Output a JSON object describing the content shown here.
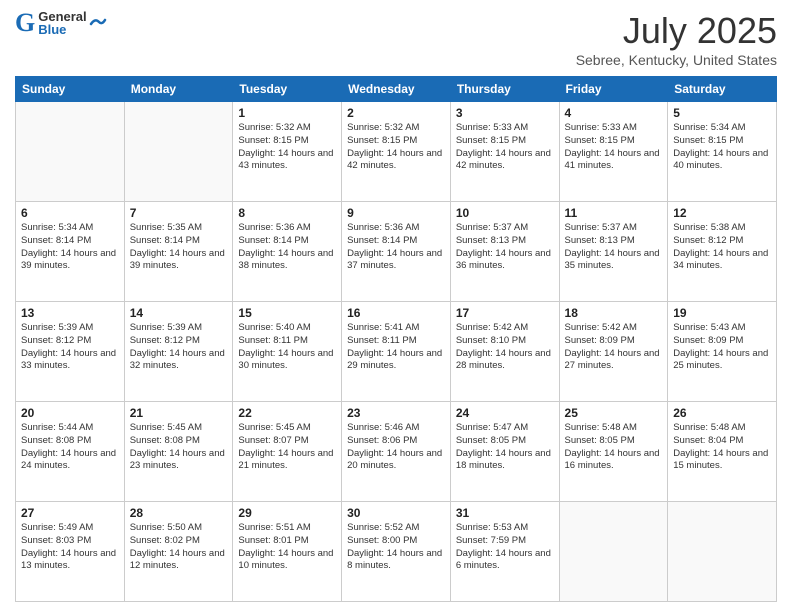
{
  "header": {
    "logo_general": "General",
    "logo_blue": "Blue",
    "title": "July 2025",
    "subtitle": "Sebree, Kentucky, United States"
  },
  "days_of_week": [
    "Sunday",
    "Monday",
    "Tuesday",
    "Wednesday",
    "Thursday",
    "Friday",
    "Saturday"
  ],
  "weeks": [
    [
      {
        "day": "",
        "content": ""
      },
      {
        "day": "",
        "content": ""
      },
      {
        "day": "1",
        "content": "Sunrise: 5:32 AM\nSunset: 8:15 PM\nDaylight: 14 hours and 43 minutes."
      },
      {
        "day": "2",
        "content": "Sunrise: 5:32 AM\nSunset: 8:15 PM\nDaylight: 14 hours and 42 minutes."
      },
      {
        "day": "3",
        "content": "Sunrise: 5:33 AM\nSunset: 8:15 PM\nDaylight: 14 hours and 42 minutes."
      },
      {
        "day": "4",
        "content": "Sunrise: 5:33 AM\nSunset: 8:15 PM\nDaylight: 14 hours and 41 minutes."
      },
      {
        "day": "5",
        "content": "Sunrise: 5:34 AM\nSunset: 8:15 PM\nDaylight: 14 hours and 40 minutes."
      }
    ],
    [
      {
        "day": "6",
        "content": "Sunrise: 5:34 AM\nSunset: 8:14 PM\nDaylight: 14 hours and 39 minutes."
      },
      {
        "day": "7",
        "content": "Sunrise: 5:35 AM\nSunset: 8:14 PM\nDaylight: 14 hours and 39 minutes."
      },
      {
        "day": "8",
        "content": "Sunrise: 5:36 AM\nSunset: 8:14 PM\nDaylight: 14 hours and 38 minutes."
      },
      {
        "day": "9",
        "content": "Sunrise: 5:36 AM\nSunset: 8:14 PM\nDaylight: 14 hours and 37 minutes."
      },
      {
        "day": "10",
        "content": "Sunrise: 5:37 AM\nSunset: 8:13 PM\nDaylight: 14 hours and 36 minutes."
      },
      {
        "day": "11",
        "content": "Sunrise: 5:37 AM\nSunset: 8:13 PM\nDaylight: 14 hours and 35 minutes."
      },
      {
        "day": "12",
        "content": "Sunrise: 5:38 AM\nSunset: 8:12 PM\nDaylight: 14 hours and 34 minutes."
      }
    ],
    [
      {
        "day": "13",
        "content": "Sunrise: 5:39 AM\nSunset: 8:12 PM\nDaylight: 14 hours and 33 minutes."
      },
      {
        "day": "14",
        "content": "Sunrise: 5:39 AM\nSunset: 8:12 PM\nDaylight: 14 hours and 32 minutes."
      },
      {
        "day": "15",
        "content": "Sunrise: 5:40 AM\nSunset: 8:11 PM\nDaylight: 14 hours and 30 minutes."
      },
      {
        "day": "16",
        "content": "Sunrise: 5:41 AM\nSunset: 8:11 PM\nDaylight: 14 hours and 29 minutes."
      },
      {
        "day": "17",
        "content": "Sunrise: 5:42 AM\nSunset: 8:10 PM\nDaylight: 14 hours and 28 minutes."
      },
      {
        "day": "18",
        "content": "Sunrise: 5:42 AM\nSunset: 8:09 PM\nDaylight: 14 hours and 27 minutes."
      },
      {
        "day": "19",
        "content": "Sunrise: 5:43 AM\nSunset: 8:09 PM\nDaylight: 14 hours and 25 minutes."
      }
    ],
    [
      {
        "day": "20",
        "content": "Sunrise: 5:44 AM\nSunset: 8:08 PM\nDaylight: 14 hours and 24 minutes."
      },
      {
        "day": "21",
        "content": "Sunrise: 5:45 AM\nSunset: 8:08 PM\nDaylight: 14 hours and 23 minutes."
      },
      {
        "day": "22",
        "content": "Sunrise: 5:45 AM\nSunset: 8:07 PM\nDaylight: 14 hours and 21 minutes."
      },
      {
        "day": "23",
        "content": "Sunrise: 5:46 AM\nSunset: 8:06 PM\nDaylight: 14 hours and 20 minutes."
      },
      {
        "day": "24",
        "content": "Sunrise: 5:47 AM\nSunset: 8:05 PM\nDaylight: 14 hours and 18 minutes."
      },
      {
        "day": "25",
        "content": "Sunrise: 5:48 AM\nSunset: 8:05 PM\nDaylight: 14 hours and 16 minutes."
      },
      {
        "day": "26",
        "content": "Sunrise: 5:48 AM\nSunset: 8:04 PM\nDaylight: 14 hours and 15 minutes."
      }
    ],
    [
      {
        "day": "27",
        "content": "Sunrise: 5:49 AM\nSunset: 8:03 PM\nDaylight: 14 hours and 13 minutes."
      },
      {
        "day": "28",
        "content": "Sunrise: 5:50 AM\nSunset: 8:02 PM\nDaylight: 14 hours and 12 minutes."
      },
      {
        "day": "29",
        "content": "Sunrise: 5:51 AM\nSunset: 8:01 PM\nDaylight: 14 hours and 10 minutes."
      },
      {
        "day": "30",
        "content": "Sunrise: 5:52 AM\nSunset: 8:00 PM\nDaylight: 14 hours and 8 minutes."
      },
      {
        "day": "31",
        "content": "Sunrise: 5:53 AM\nSunset: 7:59 PM\nDaylight: 14 hours and 6 minutes."
      },
      {
        "day": "",
        "content": ""
      },
      {
        "day": "",
        "content": ""
      }
    ]
  ]
}
